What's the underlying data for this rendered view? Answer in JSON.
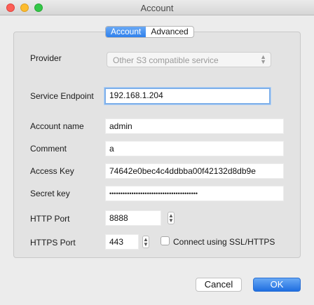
{
  "window": {
    "title": "Account"
  },
  "tabs": [
    {
      "label": "Account",
      "selected": true
    },
    {
      "label": "Advanced",
      "selected": false
    }
  ],
  "fields": {
    "provider": {
      "label": "Provider",
      "value": "Other S3 compatible service"
    },
    "service_endpoint": {
      "label": "Service Endpoint",
      "value": "192.168.1.204"
    },
    "account_name": {
      "label": "Account name",
      "value": "admin"
    },
    "comment": {
      "label": "Comment",
      "value": "a"
    },
    "access_key": {
      "label": "Access Key",
      "value": "74642e0bec4c4ddbba00f42132d8db9e"
    },
    "secret_key": {
      "label": "Secret key",
      "value": "••••••••••••••••••••••••••••••••••••••••"
    },
    "http_port": {
      "label": "HTTP Port",
      "value": "8888"
    },
    "https_port": {
      "label": "HTTPS Port",
      "value": "443"
    }
  },
  "ssl": {
    "label": "Connect using SSL/HTTPS",
    "checked": false
  },
  "buttons": {
    "cancel": "Cancel",
    "ok": "OK"
  },
  "colors": {
    "accent": "#2f80ec",
    "close": "#fc5f57",
    "minimize": "#fdbc2e",
    "maximize": "#33c748"
  }
}
